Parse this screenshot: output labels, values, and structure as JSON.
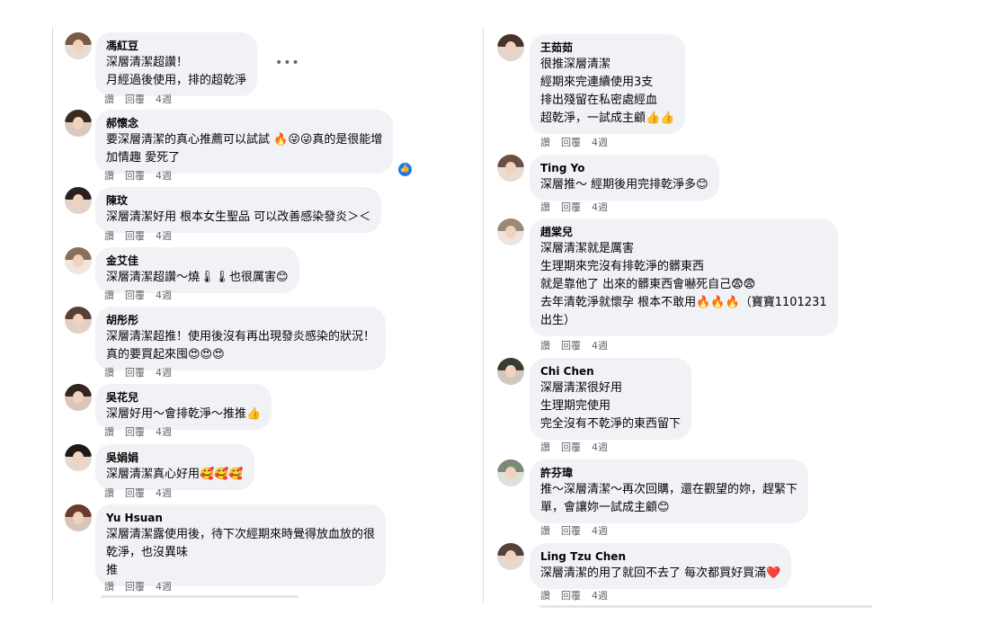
{
  "ui": {
    "like_label": "讚",
    "reply_label": "回覆"
  },
  "left_comments": [
    {
      "name": "馮紅豆",
      "lines": [
        "深層清潔超讚！",
        "月經過後使用，排的超乾淨"
      ],
      "time": "4週"
    },
    {
      "name": "郝懷念",
      "lines": [
        "要深層清潔的真心推薦可以試試 🔥😜😜真的是很能增",
        "加情趣 愛死了"
      ],
      "time": "4週"
    },
    {
      "name": "陳玟",
      "lines": [
        "深層清潔好用 根本女生聖品 可以改善感染發炎＞＜"
      ],
      "time": "4週"
    },
    {
      "name": "金艾佳",
      "lines": [
        "深層清潔超讚～燒🌡🌡也很厲害😊"
      ],
      "time": "4週"
    },
    {
      "name": "胡彤彤",
      "lines": [
        "深層清潔超推！使用後沒有再出現發炎感染的狀況！",
        "真的要買起來囤😍😍😍"
      ],
      "time": "4週"
    },
    {
      "name": "吳花兒",
      "lines": [
        "深層好用～會排乾淨～推推👍"
      ],
      "time": "4週"
    },
    {
      "name": "吳娟娟",
      "lines": [
        "深層清潔真心好用🥰🥰🥰"
      ],
      "time": "4週"
    },
    {
      "name": "Yu Hsuan",
      "lines": [
        "深層清潔露使用後，待下次經期來時覺得放血放的很",
        "乾淨，也沒異味",
        "推"
      ],
      "time": "4週"
    }
  ],
  "right_comments": [
    {
      "name": "王茹茹",
      "lines": [
        "很推深層清潔",
        "經期來完連續使用3支",
        "排出殘留在私密處經血",
        "超乾淨，一試成主顧👍👍"
      ],
      "time": "4週"
    },
    {
      "name": "Ting Yo",
      "lines": [
        "深層推～ 經期後用完排乾淨多😊"
      ],
      "time": "4週"
    },
    {
      "name": "趙棠兒",
      "lines": [
        "深層清潔就是厲害",
        "生理期來完沒有排乾淨的髒東西",
        "就是靠他了 出來的髒東西會嚇死自己😨😨",
        "去年清乾淨就懷孕 根本不敢用🔥🔥🔥（寶寶1101231",
        "出生）"
      ],
      "time": "4週"
    },
    {
      "name": "Chi Chen",
      "lines": [
        "深層清潔很好用",
        "生理期完使用",
        "完全沒有不乾淨的東西留下"
      ],
      "time": "4週"
    },
    {
      "name": "許芬瑋",
      "lines": [
        "推～深層清潔～再次回購，還在觀望的妳，趕緊下",
        "單，會讓妳一試成主顧😊"
      ],
      "time": "4週"
    },
    {
      "name": "Ling Tzu Chen",
      "lines": [
        "深層清潔的用了就回不去了 每次都買好買滿❤️"
      ],
      "time": "4週"
    }
  ],
  "colors": {
    "bubble": "#f0f2f5",
    "meta": "#65676b",
    "like_blue": "#1877f2"
  },
  "icons": {
    "more": "more-icon",
    "like_reaction": "like-reaction-icon"
  },
  "more_label": "•••",
  "like_glyph": "👍"
}
